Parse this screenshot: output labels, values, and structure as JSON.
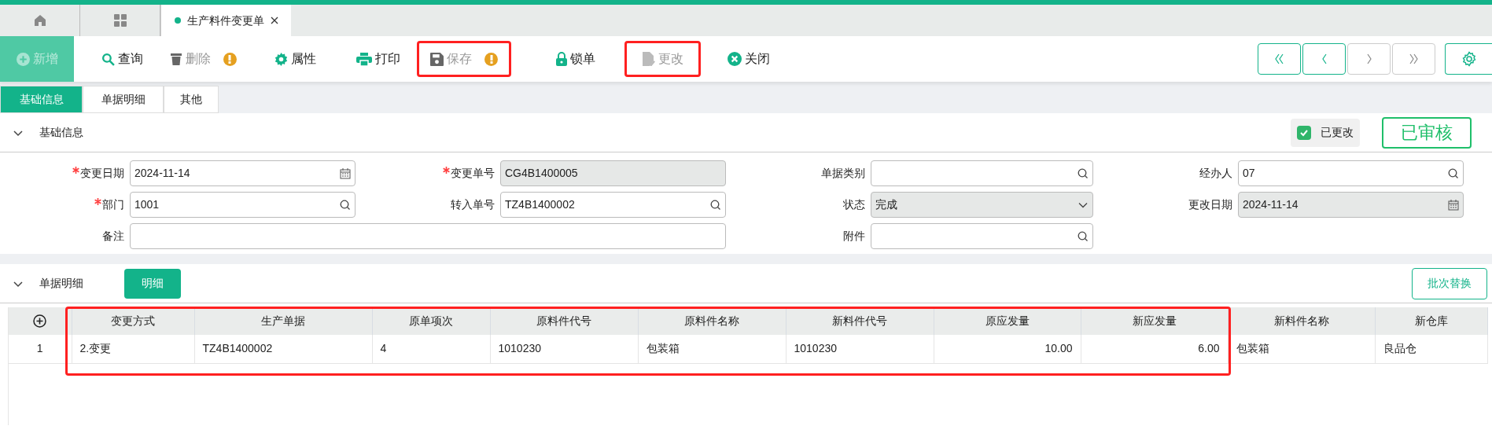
{
  "tabs": [
    {
      "kind": "home",
      "selected": false
    },
    {
      "kind": "grid",
      "selected": false
    },
    {
      "kind": "page",
      "label": "生产料件变更单",
      "selected": true
    }
  ],
  "toolbar": [
    {
      "label": "新增",
      "disabled": true,
      "warning": false,
      "highlighted": false
    },
    {
      "label": "查询",
      "disabled": false,
      "warning": false,
      "highlighted": false
    },
    {
      "label": "删除",
      "disabled": true,
      "warning": true,
      "highlighted": false
    },
    {
      "label": "属性",
      "disabled": false,
      "warning": false,
      "highlighted": false
    },
    {
      "label": "打印",
      "disabled": false,
      "warning": false,
      "highlighted": false
    },
    {
      "label": "保存",
      "disabled": true,
      "warning": true,
      "highlighted": true
    },
    {
      "label": "锁单",
      "disabled": false,
      "warning": false,
      "highlighted": false
    },
    {
      "label": "更改",
      "disabled": true,
      "warning": false,
      "highlighted": true
    },
    {
      "label": "关闭",
      "disabled": false,
      "warning": false,
      "highlighted": false
    }
  ],
  "nav_buttons": [
    {
      "disabled": false
    },
    {
      "disabled": false
    },
    {
      "disabled": true
    },
    {
      "disabled": true
    }
  ],
  "section_tabs": [
    {
      "label": "基础信息",
      "selected": true
    },
    {
      "label": "单据明细",
      "selected": false
    },
    {
      "label": "其他",
      "selected": false
    }
  ],
  "basic_info": {
    "title": "基础信息",
    "changed": {
      "label": "已更改",
      "checked": true
    },
    "status_badge": "已审核",
    "fields": [
      {
        "label": "变更日期",
        "required": true,
        "value": "2024-11-14",
        "kind": "date",
        "readonly": false
      },
      {
        "label": "变更单号",
        "required": true,
        "value": "CG4B1400005",
        "kind": "text",
        "readonly": true
      },
      {
        "label": "单据类别",
        "required": false,
        "kind": "search",
        "readonly": false
      },
      {
        "label": "经办人",
        "required": false,
        "value": "07",
        "kind": "search",
        "readonly": false
      },
      {
        "label": "部门",
        "required": true,
        "value": "1001",
        "kind": "search",
        "readonly": false
      },
      {
        "label": "转入单号",
        "required": false,
        "value": "TZ4B1400002",
        "kind": "search",
        "readonly": false
      },
      {
        "label": "状态",
        "required": false,
        "value": "完成",
        "kind": "select",
        "readonly": true
      },
      {
        "label": "更改日期",
        "required": false,
        "value": "2024-11-14",
        "kind": "date",
        "readonly": true
      },
      {
        "label": "备注",
        "required": false,
        "kind": "wide",
        "readonly": false
      },
      {
        "label": "附件",
        "required": false,
        "kind": "search",
        "readonly": false
      }
    ]
  },
  "detail": {
    "title": "单据明细",
    "tab_button": "明细",
    "batch_button": "批次替换",
    "table": {
      "columns": [
        {
          "label": "变更方式",
          "highlighted": true
        },
        {
          "label": "生产单据",
          "highlighted": true
        },
        {
          "label": "原单项次",
          "highlighted": true
        },
        {
          "label": "原料件代号",
          "highlighted": true
        },
        {
          "label": "原料件名称",
          "highlighted": true
        },
        {
          "label": "新料件代号",
          "highlighted": true
        },
        {
          "label": "原应发量",
          "highlighted": true
        },
        {
          "label": "新应发量",
          "highlighted": true
        },
        {
          "label": "新料件名称",
          "highlighted": false
        },
        {
          "label": "新仓库",
          "highlighted": false
        }
      ],
      "rows": [
        {
          "index": "1",
          "cells": [
            "2.变更",
            "TZ4B1400002",
            "4",
            "1010230",
            "包装箱",
            "1010230",
            "10.00",
            "6.00",
            "包装箱",
            "良品仓"
          ]
        }
      ]
    }
  }
}
